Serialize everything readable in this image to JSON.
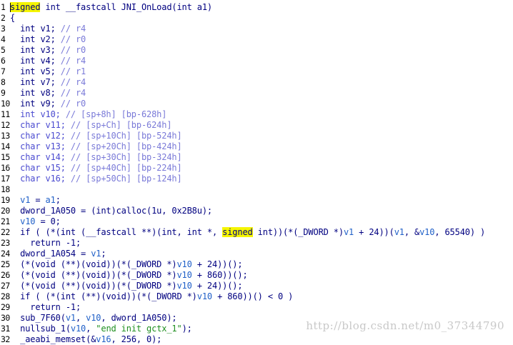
{
  "code_lines": [
    {
      "n": "1",
      "tokens": [
        [
          "h",
          "signed"
        ],
        [
          "n",
          " int __fastcall JNI_OnLoad(int a1)"
        ]
      ]
    },
    {
      "n": "2",
      "tokens": [
        [
          "n",
          "{"
        ]
      ]
    },
    {
      "n": "3",
      "tokens": [
        [
          "n",
          "  int v1; "
        ],
        [
          "c",
          "// r4"
        ]
      ]
    },
    {
      "n": "4",
      "tokens": [
        [
          "n",
          "  int v2; "
        ],
        [
          "c",
          "// r0"
        ]
      ]
    },
    {
      "n": "5",
      "tokens": [
        [
          "n",
          "  int v3; "
        ],
        [
          "c",
          "// r0"
        ]
      ]
    },
    {
      "n": "6",
      "tokens": [
        [
          "n",
          "  int v4; "
        ],
        [
          "c",
          "// r4"
        ]
      ]
    },
    {
      "n": "7",
      "tokens": [
        [
          "n",
          "  int v5; "
        ],
        [
          "c",
          "// r1"
        ]
      ]
    },
    {
      "n": "8",
      "tokens": [
        [
          "n",
          "  int v7; "
        ],
        [
          "c",
          "// r4"
        ]
      ]
    },
    {
      "n": "9",
      "tokens": [
        [
          "n",
          "  int v8; "
        ],
        [
          "c",
          "// r4"
        ]
      ]
    },
    {
      "n": "10",
      "tokens": [
        [
          "n",
          "  int v9; "
        ],
        [
          "c",
          "// r0"
        ]
      ]
    },
    {
      "n": "11",
      "tokens": [
        [
          "m",
          "  int v10; "
        ],
        [
          "c",
          "// [sp+8h] [bp-628h]"
        ]
      ]
    },
    {
      "n": "12",
      "tokens": [
        [
          "m",
          "  char v11; "
        ],
        [
          "c",
          "// [sp+Ch] [bp-624h]"
        ]
      ]
    },
    {
      "n": "13",
      "tokens": [
        [
          "m",
          "  char v12; "
        ],
        [
          "c",
          "// [sp+10Ch] [bp-524h]"
        ]
      ]
    },
    {
      "n": "14",
      "tokens": [
        [
          "m",
          "  char v13; "
        ],
        [
          "c",
          "// [sp+20Ch] [bp-424h]"
        ]
      ]
    },
    {
      "n": "15",
      "tokens": [
        [
          "m",
          "  char v14; "
        ],
        [
          "c",
          "// [sp+30Ch] [bp-324h]"
        ]
      ]
    },
    {
      "n": "16",
      "tokens": [
        [
          "m",
          "  char v15; "
        ],
        [
          "c",
          "// [sp+40Ch] [bp-224h]"
        ]
      ]
    },
    {
      "n": "17",
      "tokens": [
        [
          "m",
          "  char v16; "
        ],
        [
          "c",
          "// [sp+50Ch] [bp-124h]"
        ]
      ]
    },
    {
      "n": "18",
      "tokens": [
        [
          "n",
          ""
        ]
      ]
    },
    {
      "n": "19",
      "tokens": [
        [
          "v",
          "  v1"
        ],
        [
          "n",
          " = "
        ],
        [
          "v",
          "a1"
        ],
        [
          "n",
          ";"
        ]
      ]
    },
    {
      "n": "20",
      "tokens": [
        [
          "n",
          "  dword_1A050 = (int)calloc(1u, 0x2B8u);"
        ]
      ]
    },
    {
      "n": "21",
      "tokens": [
        [
          "v",
          "  v10"
        ],
        [
          "n",
          " = 0;"
        ]
      ]
    },
    {
      "n": "22",
      "tokens": [
        [
          "n",
          "  if ( (*(int (__fastcall **)(int, int *, "
        ],
        [
          "h",
          "signed"
        ],
        [
          "n",
          " int))(*(_DWORD *)"
        ],
        [
          "v",
          "v1"
        ],
        [
          "n",
          " + 24))("
        ],
        [
          "v",
          "v1"
        ],
        [
          "n",
          ", &"
        ],
        [
          "v",
          "v10"
        ],
        [
          "n",
          ", 65540) )"
        ]
      ]
    },
    {
      "n": "23",
      "tokens": [
        [
          "n",
          "    return -1;"
        ]
      ]
    },
    {
      "n": "24",
      "tokens": [
        [
          "n",
          "  dword_1A054 = "
        ],
        [
          "v",
          "v1"
        ],
        [
          "n",
          ";"
        ]
      ]
    },
    {
      "n": "25",
      "tokens": [
        [
          "n",
          "  (*(void (**)(void))(*(_DWORD *)"
        ],
        [
          "v",
          "v10"
        ],
        [
          "n",
          " + 24))();"
        ]
      ]
    },
    {
      "n": "26",
      "tokens": [
        [
          "n",
          "  (*(void (**)(void))(*(_DWORD *)"
        ],
        [
          "v",
          "v10"
        ],
        [
          "n",
          " + 860))();"
        ]
      ]
    },
    {
      "n": "27",
      "tokens": [
        [
          "n",
          "  (*(void (**)(void))(*(_DWORD *)"
        ],
        [
          "v",
          "v10"
        ],
        [
          "n",
          " + 24))();"
        ]
      ]
    },
    {
      "n": "28",
      "tokens": [
        [
          "n",
          "  if ( (*(int (**)(void))(*(_DWORD *)"
        ],
        [
          "v",
          "v10"
        ],
        [
          "n",
          " + 860))() < 0 )"
        ]
      ]
    },
    {
      "n": "29",
      "tokens": [
        [
          "n",
          "    return -1;"
        ]
      ]
    },
    {
      "n": "30",
      "tokens": [
        [
          "n",
          "  sub_7F60("
        ],
        [
          "v",
          "v1"
        ],
        [
          "n",
          ", "
        ],
        [
          "v",
          "v10"
        ],
        [
          "n",
          ", dword_1A050);"
        ]
      ]
    },
    {
      "n": "31",
      "tokens": [
        [
          "n",
          "  nullsub_1("
        ],
        [
          "v",
          "v10"
        ],
        [
          "n",
          ", "
        ],
        [
          "s",
          "\"end init gctx_1\""
        ],
        [
          "n",
          ");"
        ]
      ]
    },
    {
      "n": "32",
      "tokens": [
        [
          "n",
          "  _aeabi_memset(&"
        ],
        [
          "v",
          "v16"
        ],
        [
          "n",
          ", 256, 0);"
        ]
      ]
    }
  ],
  "watermark": "http://blog.csdn.net/m0_37344790",
  "colors": {
    "background": "#ffffff",
    "code": "#000080",
    "variable": "#2060c8",
    "comment": "#7a7ad8",
    "string": "#1f8f1f",
    "highlight": "#f5f500"
  }
}
